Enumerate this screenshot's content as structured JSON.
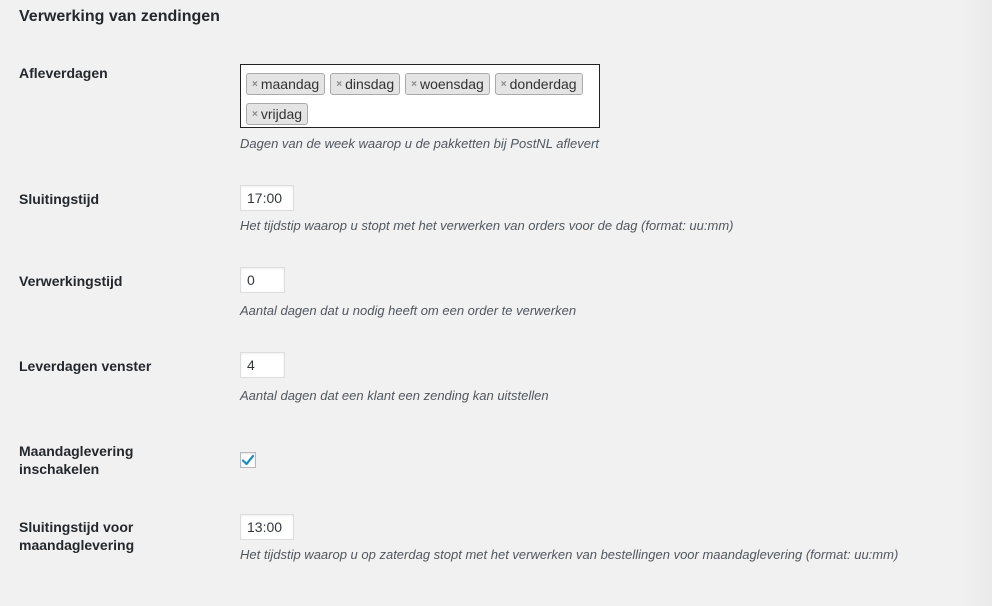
{
  "section": {
    "title": "Verwerking van zendingen"
  },
  "fields": {
    "delivery_days": {
      "label": "Afleverdagen",
      "tags": [
        "maandag",
        "dinsdag",
        "woensdag",
        "donderdag",
        "vrijdag"
      ],
      "remove_glyph": "×",
      "description": "Dagen van de week waarop u de pakketten bij PostNL aflevert"
    },
    "closing_time": {
      "label": "Sluitingstijd",
      "value": "17:00",
      "description": "Het tijdstip waarop u stopt met het verwerken van orders voor de dag (format: uu:mm)"
    },
    "processing_time": {
      "label": "Verwerkingstijd",
      "value": "0",
      "description": "Aantal dagen dat u nodig heeft om een order te verwerken"
    },
    "delivery_window": {
      "label": "Leverdagen venster",
      "value": "4",
      "description": "Aantal dagen dat een klant een zending kan uitstellen"
    },
    "monday_delivery": {
      "label_line1": "Maandaglevering",
      "label_line2": "inschakelen",
      "checked": true
    },
    "monday_closing_time": {
      "label_line1": "Sluitingstijd voor",
      "label_line2": "maandaglevering",
      "value": "13:00",
      "description": "Het tijdstip waarop u op zaterdag stopt met het verwerken van bestellingen voor maandaglevering (format: uu:mm)"
    }
  },
  "colors": {
    "check": "#1e8cbe",
    "background": "#f1f1f1"
  }
}
